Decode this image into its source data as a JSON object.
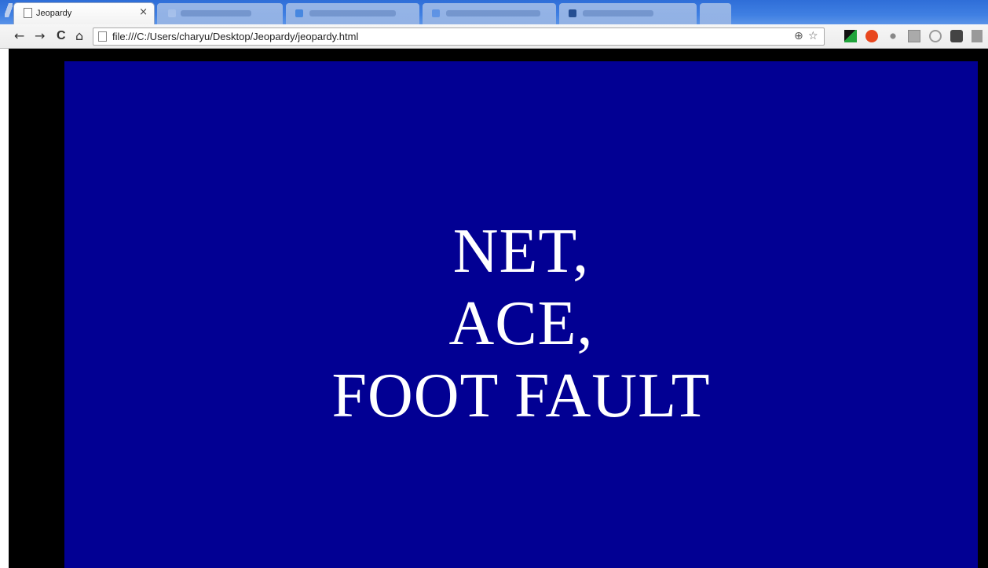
{
  "browser": {
    "active_tab": {
      "title": "Jeopardy",
      "close_glyph": "×"
    },
    "address_bar": {
      "url": "file:///C:/Users/charyu/Desktop/Jeopardy/jeopardy.html"
    },
    "nav": {
      "back": "←",
      "forward": "→",
      "reload": "C",
      "home": "⌂"
    },
    "omnibox_icons": {
      "zoom": "⊕",
      "star": "☆"
    },
    "extension_icons": [
      "flag-green-icon",
      "stumbleupon-icon",
      "feather-icon",
      "n-icon",
      "circle-icon",
      "square-icon",
      "partial-icon"
    ]
  },
  "game": {
    "clue_lines": [
      "NET,",
      "ACE,",
      "FOOT FAULT"
    ],
    "board_color": "#020093",
    "text_color": "#ffffff"
  }
}
